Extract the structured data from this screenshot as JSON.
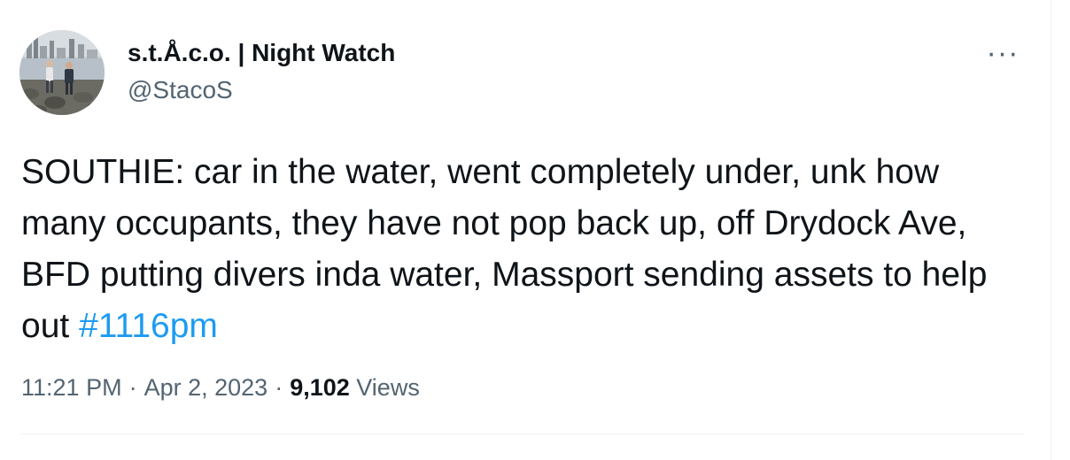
{
  "author": {
    "display_name": "s.t.Å.c.o. | Night Watch",
    "handle": "@StacoS",
    "avatar": "profile-photo-two-people-on-rocky-shore-with-city-skyline"
  },
  "actions": {
    "more_icon": "more-horizontal-icon",
    "more_label": "···"
  },
  "tweet": {
    "text": "SOUTHIE: car in the water, went completely under, unk how many occupants, they have not pop back up, off Drydock Ave, BFD putting divers inda water, Massport sending assets to help out ",
    "hashtag": "#1116pm"
  },
  "meta": {
    "time": "11:21 PM",
    "separator": "·",
    "date": "Apr 2, 2023",
    "views_count": "9,102",
    "views_label": "Views"
  },
  "colors": {
    "text": "#0f1419",
    "secondary": "#536471",
    "link": "#1d9bf0",
    "divider": "#eff3f4"
  }
}
